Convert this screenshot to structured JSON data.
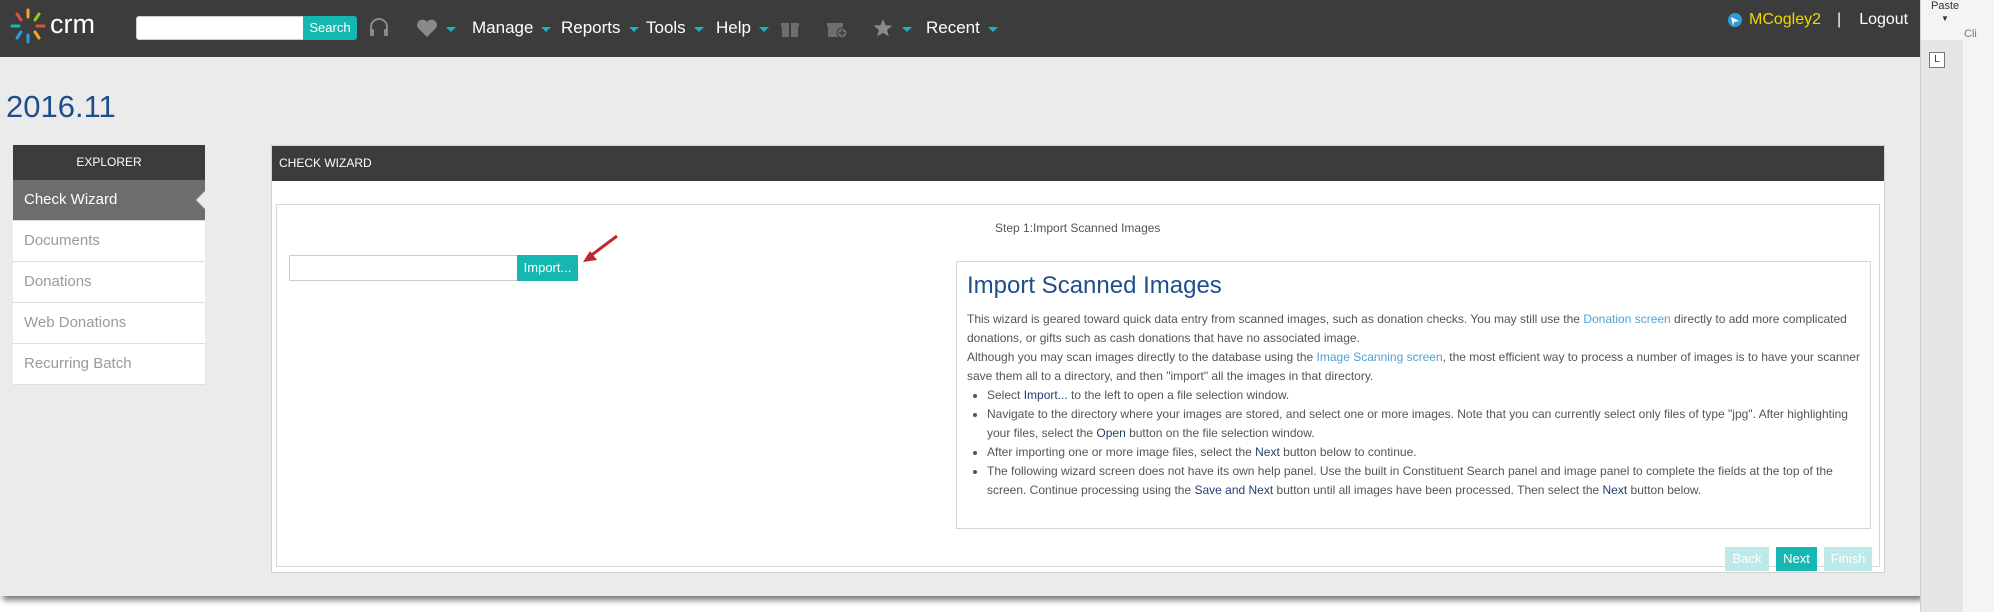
{
  "app": {
    "logo_text": "crm"
  },
  "header": {
    "search_button": "Search",
    "search_placeholder": "",
    "nav": [
      {
        "label": "Manage"
      },
      {
        "label": "Reports"
      },
      {
        "label": "Tools"
      },
      {
        "label": "Help"
      },
      {
        "label": "Recent"
      }
    ],
    "user": "MCogley2",
    "separator": "|",
    "logout": "Logout"
  },
  "page": {
    "title": "2016.11"
  },
  "explorer": {
    "heading": "EXPLORER",
    "items": [
      {
        "label": "Check Wizard",
        "active": true
      },
      {
        "label": "Documents"
      },
      {
        "label": "Donations"
      },
      {
        "label": "Web Donations"
      },
      {
        "label": "Recurring Batch"
      }
    ]
  },
  "wizard": {
    "heading": "CHECK WIZARD",
    "step": "Step 1:Import Scanned Images",
    "import_button": "Import...",
    "help": {
      "title": "Import Scanned Images",
      "p1_a": "This wizard is geared toward quick data entry from scanned images, such as donation checks. You may still use the ",
      "p1_link": "Donation screen",
      "p1_b": " directly to add more complicated donations, or gifts such as cash donations that have no associated image.",
      "p2_a": "Although you may scan images directly to the database using the ",
      "p2_link": "Image Scanning screen",
      "p2_b": ", the most efficient way to process a number of images is to have your scanner save them all to a directory, and then \"import\" all the images in that directory.",
      "b1_a": "Select ",
      "b1_bold": "Import...",
      "b1_b": " to the left to open a file selection window.",
      "b2_a": "Navigate to the directory where your images are stored, and select one or more images. Note that you can currently select only files of type \"jpg\". After highlighting your files, select the ",
      "b2_bold": "Open",
      "b2_b": " button on the file selection window.",
      "b3_a": "After importing one or more image files, select the ",
      "b3_bold": "Next",
      "b3_b": " button below to continue.",
      "b4_a": "The following wizard screen does not have its own help panel. Use the built in Constituent Search panel and image panel to complete the fields at the top of the screen. Continue processing using the ",
      "b4_bold1": "Save and Next",
      "b4_b": " button until all images have been processed. Then select the ",
      "b4_bold2": "Next",
      "b4_c": " button below."
    },
    "buttons": {
      "back": "Back",
      "next": "Next",
      "finish": "Finish"
    }
  },
  "ribbon": {
    "paste": "Paste",
    "paste_caret": "▼",
    "clip": "Cli",
    "tab_icon": "L"
  },
  "colors": {
    "accent": "#17b7b1",
    "dark_bar": "#3c3c3c",
    "title": "#1f4e8c",
    "user": "#f2d600",
    "arrow": "#c0282d"
  }
}
